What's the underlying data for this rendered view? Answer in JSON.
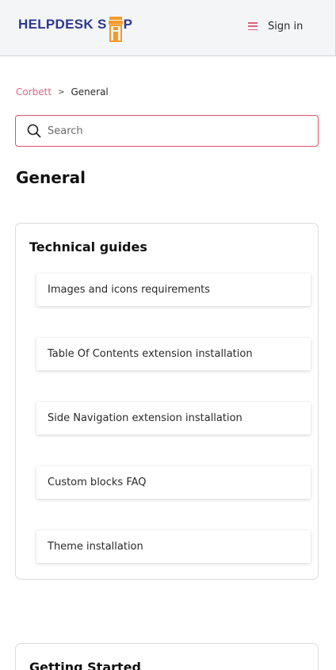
{
  "header": {
    "logo_text_left": "HELPDESK S",
    "logo_text_right": "P",
    "logo_icon": "shop-storefront-icon",
    "menu_icon": "hamburger-menu-icon",
    "signin_label": "Sign in"
  },
  "breadcrumb": {
    "parent": "Corbett",
    "separator": ">",
    "current": "General"
  },
  "search": {
    "placeholder": "Search",
    "icon": "search-icon"
  },
  "page": {
    "title": "General"
  },
  "sections": [
    {
      "title": "Technical guides",
      "articles": [
        "Images and icons requirements",
        "Table Of Contents extension installation",
        "Side Navigation extension installation",
        "Custom blocks FAQ",
        "Theme installation"
      ]
    },
    {
      "title": "Getting Started",
      "articles": []
    }
  ],
  "colors": {
    "accent": "#e0697c",
    "brand_blue": "#2b3990",
    "brand_orange": "#f39a2b",
    "search_border": "#d9536c"
  }
}
